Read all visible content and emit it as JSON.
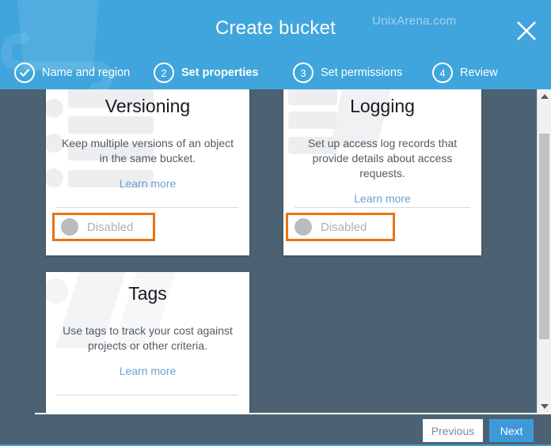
{
  "header": {
    "title": "Create bucket",
    "watermark": "UnixArena.com",
    "close_icon": "close-icon",
    "bg_color": "#40a5dc",
    "steps": [
      {
        "badge": "✓",
        "label": "Name and region",
        "state": "done"
      },
      {
        "badge": "2",
        "label": "Set properties",
        "state": "active"
      },
      {
        "badge": "3",
        "label": "Set permissions",
        "state": "upcoming"
      },
      {
        "badge": "4",
        "label": "Review",
        "state": "upcoming"
      }
    ]
  },
  "content": {
    "bg_color": "#4c6272",
    "cards": [
      {
        "id": "versioning",
        "title": "Versioning",
        "description": "Keep multiple versions of an object in the same bucket.",
        "link_label": "Learn more",
        "toggle_label": "Disabled",
        "toggle_state": "off",
        "highlight_color": "#ec7211"
      },
      {
        "id": "logging",
        "title": "Logging",
        "description": "Set up access log records that provide details about access requests.",
        "link_label": "Learn more",
        "toggle_label": "Disabled",
        "toggle_state": "off",
        "highlight_color": "#ec7211"
      },
      {
        "id": "tags",
        "title": "Tags",
        "description": "Use tags to track your cost against projects or other criteria.",
        "link_label": "Learn more"
      }
    ]
  },
  "scrollbar": {
    "up_icon": "triangle-up-icon",
    "down_icon": "triangle-down-icon",
    "orientation": "vertical"
  },
  "footer": {
    "previous_label": "Previous",
    "next_label": "Next",
    "next_color": "#3d9ad9"
  }
}
